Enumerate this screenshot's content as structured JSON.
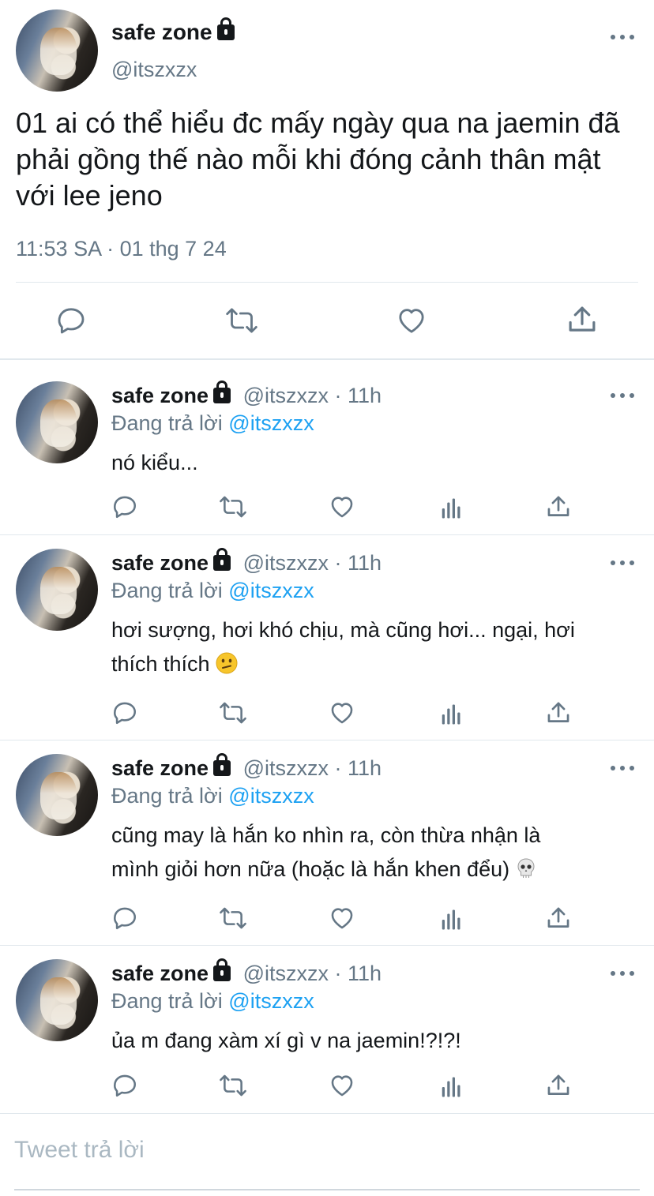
{
  "main_tweet": {
    "display_name": "safe zone",
    "handle": "@itszxzx",
    "text": "01 ai có thể hiểu đc mấy ngày qua na jaemin đã phải gồng thế nào mỗi khi đóng cảnh thân mật với lee jeno",
    "timestamp": "11:53 SA · 01 thg 7 24",
    "actions": [
      "reply-icon",
      "retweet-icon",
      "like-icon",
      "share-icon"
    ]
  },
  "replies": [
    {
      "display_name": "safe zone",
      "handle_time": "@itszxzx · 11h",
      "replying_label": "Đang trả lời",
      "replying_to": "@itszxzx",
      "text": "nó kiểu..."
    },
    {
      "display_name": "safe zone",
      "handle_time": "@itszxzx · 11h",
      "replying_label": "Đang trả lời",
      "replying_to": "@itszxzx",
      "text_line1": "hơi sượng, hơi khó chịu, mà cũng hơi... ngại, hơi",
      "text_line2": "thích thích",
      "emoji": "confused-face"
    },
    {
      "display_name": "safe zone",
      "handle_time": "@itszxzx · 11h",
      "replying_label": "Đang trả lời",
      "replying_to": "@itszxzx",
      "text_line1": "cũng may là hắn ko nhìn ra, còn thừa nhận là",
      "text_line2": "mình giỏi hơn nữa (hoặc là hắn khen đểu)",
      "emoji": "skull"
    },
    {
      "display_name": "safe zone",
      "handle_time": "@itszxzx · 11h",
      "replying_label": "Đang trả lời",
      "replying_to": "@itszxzx",
      "text": "ủa m đang xàm xí gì v na jaemin!?!?!"
    }
  ],
  "compose": {
    "placeholder": "Tweet trả lời"
  },
  "colors": {
    "text": "#14171a",
    "secondary": "#657786",
    "link": "#1da1f2",
    "divider": "#e1e8ed"
  }
}
